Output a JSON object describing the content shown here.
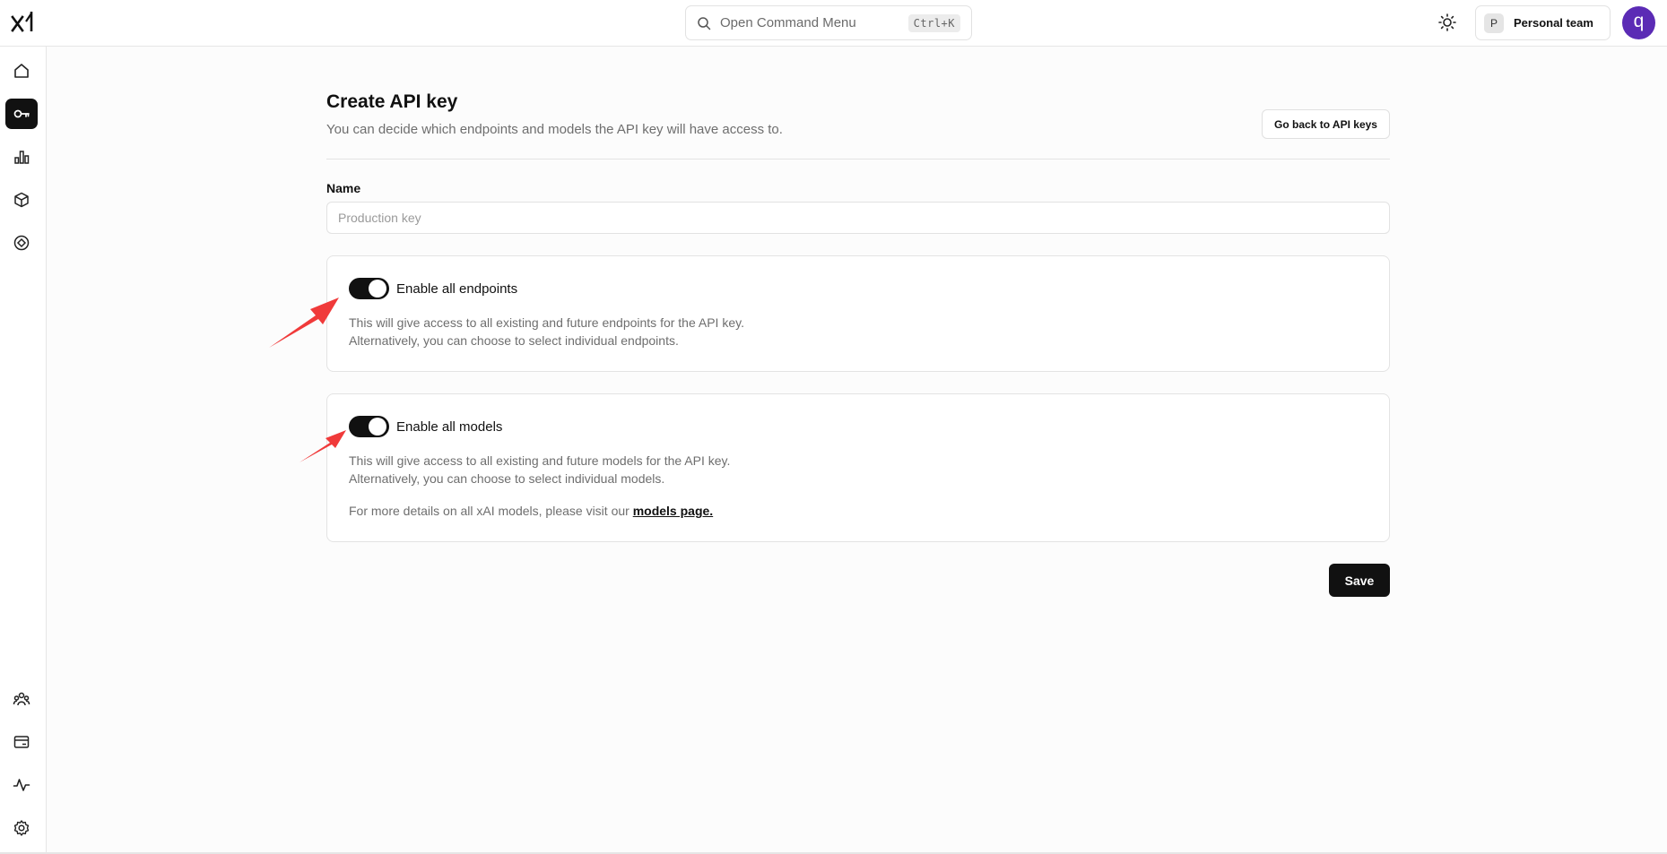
{
  "topbar": {
    "command_menu_placeholder": "Open Command Menu",
    "command_menu_shortcut": "Ctrl+K",
    "team_badge": "P",
    "team_name": "Personal team",
    "avatar_initial": "q"
  },
  "sidebar": {
    "top_items": [
      {
        "icon": "home-icon",
        "active": false
      },
      {
        "icon": "key-icon",
        "active": true
      },
      {
        "icon": "bar-chart-icon",
        "active": false
      },
      {
        "icon": "cube-icon",
        "active": false
      },
      {
        "icon": "compass-icon",
        "active": false
      }
    ],
    "bottom_items": [
      {
        "icon": "team-icon"
      },
      {
        "icon": "billing-icon"
      },
      {
        "icon": "activity-icon"
      },
      {
        "icon": "settings-icon"
      }
    ]
  },
  "page": {
    "title": "Create API key",
    "subtitle": "You can decide which endpoints and models the API key will have access to.",
    "back_button": "Go back to API keys",
    "name_label": "Name",
    "name_placeholder": "Production key",
    "name_value": ""
  },
  "endpoints_card": {
    "toggle_label": "Enable all endpoints",
    "toggle_on": true,
    "desc_line1": "This will give access to all existing and future endpoints for the API key.",
    "desc_line2": "Alternatively, you can choose to select individual endpoints."
  },
  "models_card": {
    "toggle_label": "Enable all models",
    "toggle_on": true,
    "desc_line1": "This will give access to all existing and future models for the API key.",
    "desc_line2": "Alternatively, you can choose to select individual models.",
    "details_prefix": "For more details on all xAI models, please visit our ",
    "details_link": "models page."
  },
  "save_button": "Save",
  "colors": {
    "accent": "#111111",
    "avatar": "#5b2bb5",
    "annotation_arrow": "#f03a3a"
  }
}
